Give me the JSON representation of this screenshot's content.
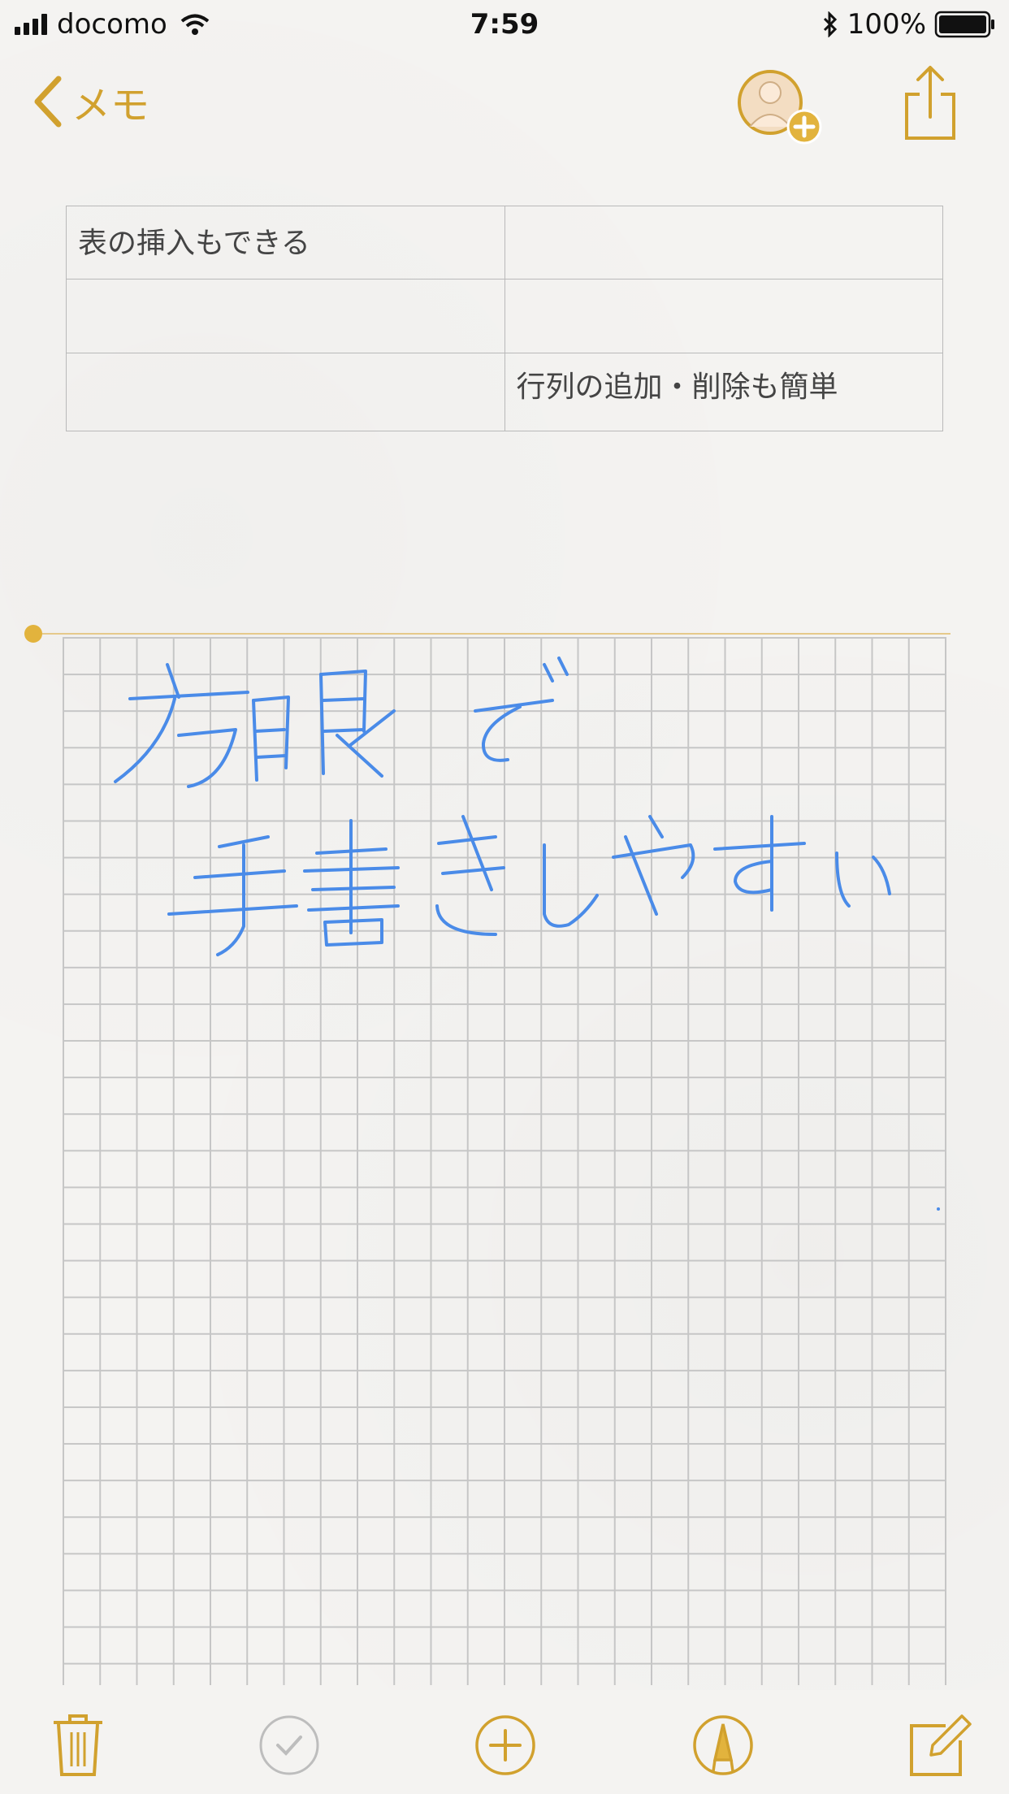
{
  "status_bar": {
    "carrier": "docomo",
    "time": "7:59",
    "battery_percent": "100%"
  },
  "nav": {
    "back_label": "メモ",
    "accent_color": "#d1a12e"
  },
  "table": {
    "rows": [
      [
        "表の挿入もできる",
        ""
      ],
      [
        "",
        ""
      ],
      [
        "",
        "行列の追加・削除も簡単"
      ]
    ]
  },
  "drawing": {
    "background": "grid",
    "ink_color": "#4a8be8"
  },
  "toolbar": {
    "icons": [
      "trash-icon",
      "checklist-icon",
      "add-icon",
      "markup-icon",
      "compose-icon"
    ]
  }
}
